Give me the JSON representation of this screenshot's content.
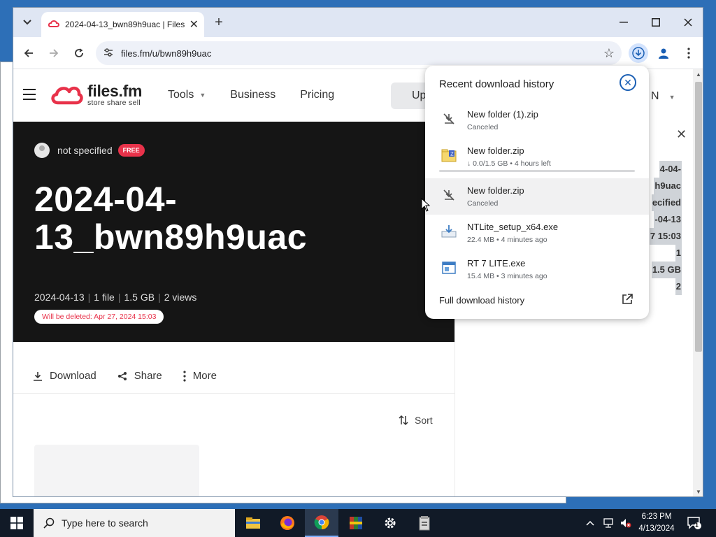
{
  "browser": {
    "tab_title": "2024-04-13_bwn89h9uac | Files",
    "url": "files.fm/u/bwn89h9uac"
  },
  "site": {
    "logo_name": "files.fm",
    "logo_tagline": "store share sell",
    "nav": [
      "Tools",
      "Business",
      "Pricing"
    ],
    "upload_label": "Up",
    "lang_label": "N"
  },
  "hero": {
    "owner": "not specified",
    "badge": "FREE",
    "title": "2024-04-13_bwn89h9uac",
    "meta_date": "2024-04-13",
    "meta_files": "1 file",
    "meta_size": "1.5 GB",
    "meta_views": "2 views",
    "delete_notice": "Will be deleted: Apr 27, 2024 15:03"
  },
  "actions": {
    "download": "Download",
    "share": "Share",
    "more": "More",
    "sort": "Sort"
  },
  "details_panel": {
    "values": [
      "4-04-",
      "h9uac",
      "ecified",
      "-04-13",
      "7 15:03",
      "1",
      "1.5 GB",
      "2"
    ]
  },
  "downloads": {
    "title": "Recent download history",
    "items": [
      {
        "name": "New folder (1).zip",
        "status": "Canceled",
        "icon": "download-off-icon"
      },
      {
        "name": "New folder.zip",
        "status": "↓ 0.0/1.5 GB • 4 hours left",
        "icon": "zip-folder-icon",
        "progress": 0.0
      },
      {
        "name": "New folder.zip",
        "status": "Canceled",
        "icon": "download-off-icon"
      },
      {
        "name": "NTLite_setup_x64.exe",
        "status": "22.4 MB • 4 minutes ago",
        "icon": "installer-icon"
      },
      {
        "name": "RT 7 LITE.exe",
        "status": "15.4 MB • 3 minutes ago",
        "icon": "app-window-icon"
      }
    ],
    "full_history": "Full download history"
  },
  "taskbar": {
    "search_placeholder": "Type here to search",
    "time": "6:23 PM",
    "date": "4/13/2024",
    "notification_count": "1"
  },
  "colors": {
    "brand_red": "#e8324a",
    "chrome_blue": "#1a5fb4",
    "hero_bg": "#151515"
  }
}
